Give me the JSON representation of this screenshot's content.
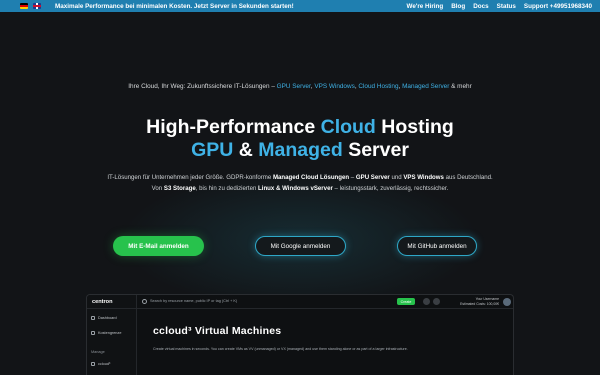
{
  "topbar": {
    "banner": "Maximale Performance bei minimalen Kosten. Jetzt Server in Sekunden starten!",
    "links": [
      "We're Hiring",
      "Blog",
      "Docs",
      "Status",
      "Support +49951968340"
    ]
  },
  "hero": {
    "kicker_prefix": "Ihre Cloud, Ihr Weg: Zukunftssichere IT-Lösungen – ",
    "kicker_links": [
      "GPU Server",
      "VPS Windows",
      "Cloud Hosting",
      "Managed Server"
    ],
    "kicker_suffix": " & mehr",
    "headline_line1_a": "High-Performance ",
    "headline_line1_b": "Cloud",
    "headline_line1_c": " Hosting",
    "headline_line2_a": "GPU",
    "headline_line2_b": " & ",
    "headline_line2_c": "Managed",
    "headline_line2_d": " Server",
    "sub_line1_a": "IT-Lösungen für Unternehmen jeder Größe. GDPR-konforme ",
    "sub_line1_b": "Managed Cloud Lösungen",
    "sub_line1_c": " – ",
    "sub_line1_d": "GPU Server",
    "sub_line1_e": " und ",
    "sub_line1_f": "VPS Windows",
    "sub_line1_g": " aus Deutschland.",
    "sub_line2_a": "Von ",
    "sub_line2_b": "S3 Storage",
    "sub_line2_c": ", bis hin zu dedizierten ",
    "sub_line2_d": "Linux & Windows vServer",
    "sub_line2_e": " – leistungsstark, zuverlässig, rechtssicher."
  },
  "buttons": {
    "email": "Mit E-Mail anmelden",
    "google": "Mit Google anmelden",
    "github": "Mit GitHub anmelden"
  },
  "app": {
    "logo": "centron",
    "search_placeholder": "Search by resource name, public IP or tag (Ctrl + K)",
    "create": "Create",
    "user_line1": "Your Username",
    "user_line2": "Estimated Costs: 100,00€",
    "sidebar": [
      "Dashboard",
      "Kostengrenze"
    ],
    "group": "Manage",
    "sidebar_bottom": "ccloud³",
    "title": "ccloud³ Virtual Machines",
    "description": "Create virtual machines in seconds. You can create VMs as VV (unmanaged) or VX (managed) and use them standing alone or as part of a larger infrastructure."
  },
  "colors": {
    "accent": "#3fb2e6",
    "topbar": "#1f7fb0",
    "green": "#27c24c",
    "background": "#121417"
  }
}
